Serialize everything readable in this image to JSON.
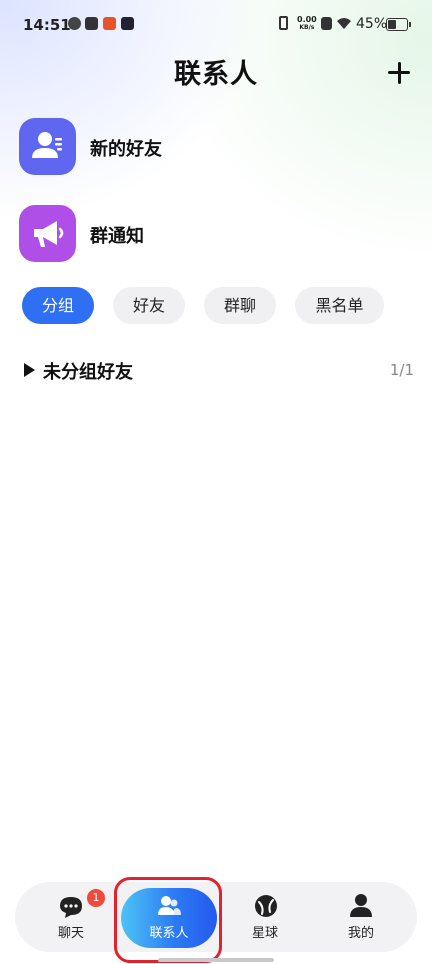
{
  "status_bar": {
    "time": "14:51",
    "net_speed_value": "0.00",
    "net_speed_unit": "KB/s",
    "battery_percent": "45%",
    "battery_level": 0.45
  },
  "header": {
    "title": "联系人"
  },
  "rows": [
    {
      "label": "新的好友",
      "icon": "new-friend-icon"
    },
    {
      "label": "群通知",
      "icon": "megaphone-icon"
    }
  ],
  "filter_chips": [
    {
      "label": "分组",
      "active": true
    },
    {
      "label": "好友",
      "active": false
    },
    {
      "label": "群聊",
      "active": false
    },
    {
      "label": "黑名单",
      "active": false
    }
  ],
  "group": {
    "name": "未分组好友",
    "count": "1/1"
  },
  "bottom_nav": {
    "items": [
      {
        "label": "聊天",
        "icon": "chat-icon",
        "badge": "1"
      },
      {
        "label": "联系人",
        "icon": "contacts-icon",
        "active": true
      },
      {
        "label": "星球",
        "icon": "planet-icon"
      },
      {
        "label": "我的",
        "icon": "profile-icon"
      }
    ]
  },
  "colors": {
    "accent": "#2f6ff3",
    "new_friend_icon_bg": "#5f66f0",
    "group_notice_icon_bg": "#b04fe8",
    "badge": "#f04a3c",
    "highlight": "#e0232d"
  }
}
